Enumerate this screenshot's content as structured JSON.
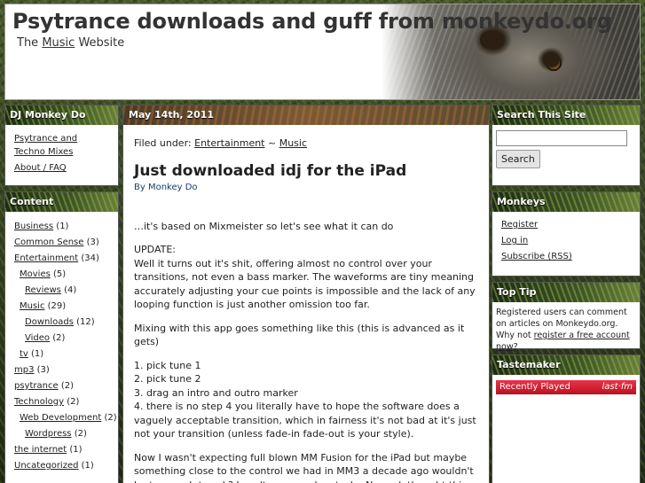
{
  "header": {
    "title": "Psytrance downloads and guff from monkeydo.org",
    "tagline_pre": "The ",
    "tagline_link": "Music",
    "tagline_post": " Website"
  },
  "sidebar_left": {
    "dj": {
      "title": "DJ Monkey Do",
      "links": [
        "Psytrance and Techno Mixes",
        "About / FAQ"
      ]
    },
    "content": {
      "title": "Content",
      "categories": [
        {
          "name": "Business",
          "count": "(1)",
          "level": 0
        },
        {
          "name": "Common Sense",
          "count": "(3)",
          "level": 0
        },
        {
          "name": "Entertainment",
          "count": "(34)",
          "level": 0
        },
        {
          "name": "Movies",
          "count": "(5)",
          "level": 1
        },
        {
          "name": "Reviews",
          "count": "(4)",
          "level": 2
        },
        {
          "name": "Music",
          "count": "(29)",
          "level": 1
        },
        {
          "name": "Downloads",
          "count": "(12)",
          "level": 2
        },
        {
          "name": "Video",
          "count": "(2)",
          "level": 2
        },
        {
          "name": "tv",
          "count": "(1)",
          "level": 1
        },
        {
          "name": "mp3",
          "count": "(3)",
          "level": 0
        },
        {
          "name": "psytrance",
          "count": "(2)",
          "level": 0
        },
        {
          "name": "Technology",
          "count": "(2)",
          "level": 0
        },
        {
          "name": "Web Development",
          "count": "(2)",
          "level": 1
        },
        {
          "name": "Wordpress",
          "count": "(2)",
          "level": 2
        },
        {
          "name": "the internet",
          "count": "(1)",
          "level": 0
        },
        {
          "name": "Uncategorized",
          "count": "(1)",
          "level": 0
        }
      ]
    }
  },
  "post": {
    "date": "May 14th, 2011",
    "filed_label": "Filed under: ",
    "filed_cat1": "Entertainment",
    "filed_sep": " ~ ",
    "filed_cat2": "Music",
    "title": "Just downloaded idj for the iPad",
    "byline": "By Monkey Do",
    "p1": "…it's based on Mixmeister so let's see what it can do",
    "p2a": "UPDATE:",
    "p2b": "Well it turns out it's shit, offering almost no control over your transitions, not even a bass marker. The waveforms are tiny meaning accurately adjusting your cue points is impossible and the lack of any looping function is just another omission too far.",
    "p3": "Mixing with this app goes something like this (this is advanced as it gets)",
    "steps": [
      "1. pick tune 1",
      "2. pick tune 2",
      "3. drag an intro and outro marker",
      "4. there is no step 4 you literally have to hope the software does a vaguely acceptable transition, which in fairness it's not bad at it's just not your transition (unless fade-in fade-out is your style)."
    ],
    "p5": "Now I wasn't expecting full blown MM Fusion for the iPad but maybe something close to the control we had in MM3 a decade ago wouldn't be too much to ask? I can't even work out who Numark thought this was aimed at, I"
  },
  "sidebar_right": {
    "search": {
      "title": "Search This Site",
      "input_value": "",
      "button": "Search"
    },
    "monkeys": {
      "title": "Monkeys",
      "links": [
        "Register",
        "Log in",
        "Subscribe (RSS)"
      ]
    },
    "tip": {
      "title": "Top Tip",
      "text1": "Registered users can comment on articles on Monkeydo.org.",
      "text2_pre": "Why not ",
      "text2_link": "register a free account now",
      "text2_post": "?"
    },
    "tastemaker": {
      "title": "Tastemaker",
      "widget_label": "Recently Played",
      "widget_logo": "last·fm"
    }
  }
}
